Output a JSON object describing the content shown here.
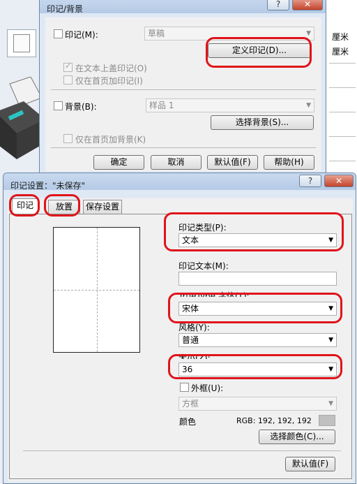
{
  "bg": {
    "right_text_1": "厘米",
    "right_text_2": "厘米"
  },
  "dlg1": {
    "title": "印记/背景",
    "help_btn": "?",
    "close_btn": "✕",
    "stamp_label": "印记(M):",
    "stamp_value": "草稿",
    "define_btn": "定义印记(D)...",
    "overlay_text": "在文本上盖印记(O)",
    "first_page_stamp": "仅在首页加印记(I)",
    "bg_label": "背景(B):",
    "bg_value": "样品 1",
    "select_bg_btn": "选择背景(S)...",
    "first_page_bg": "仅在首页加背景(K)",
    "ok_btn": "确定",
    "cancel_btn": "取消",
    "default_btn": "默认值(F)",
    "help_btn2": "帮助(H)"
  },
  "dlg2": {
    "title": "印记设置：\"未保存\"",
    "help_btn": "?",
    "close_btn": "✕",
    "tabs": [
      "印记",
      "放置",
      "保存设置"
    ],
    "type_label": "印记类型(P):",
    "type_value": "文本",
    "text_label": "印记文本(M):",
    "text_value": "",
    "font_label": "TrueType 字体(T):",
    "font_value": "宋体",
    "style_label": "风格(Y):",
    "style_value": "普通",
    "size_label": "大小(Z):",
    "size_value": "36",
    "frame_label": "外框(U):",
    "frame_value": "方框",
    "color_label": "颜色",
    "rgb_text": "RGB: 192, 192, 192",
    "choose_color_btn": "选择颜色(C)...",
    "default_btn": "默认值(F)",
    "swatch_color": "#c0c0c0"
  }
}
